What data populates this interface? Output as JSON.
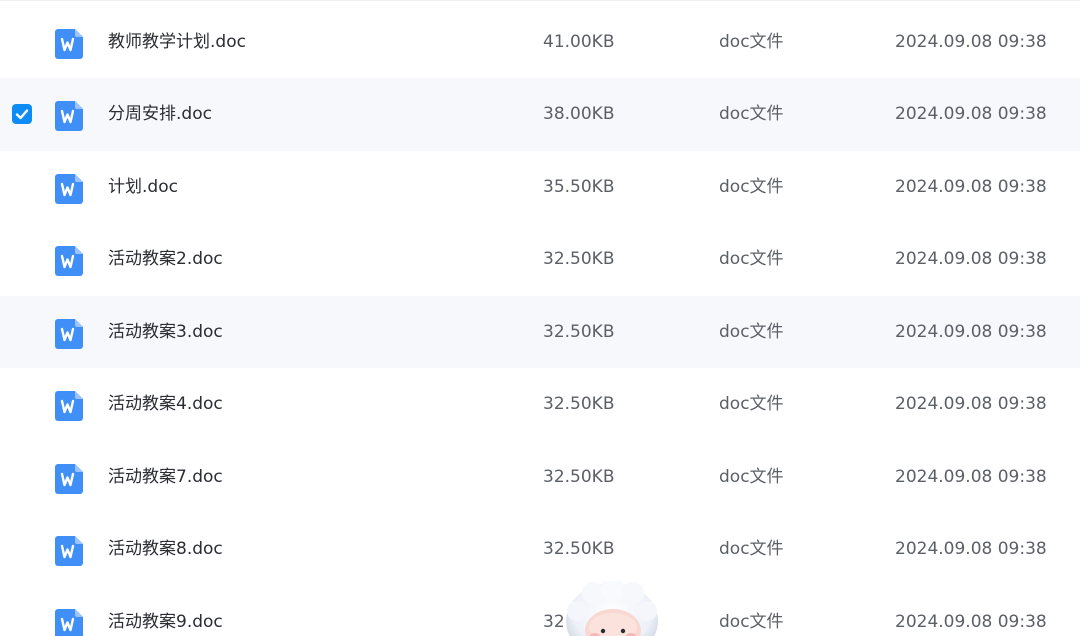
{
  "colors": {
    "accent": "#0d8cf5",
    "doc_icon": "#3f8ff7",
    "row_alt": "#f6f8fc"
  },
  "files": [
    {
      "name": "教师教学计划.doc",
      "size": "41.00KB",
      "type": "doc文件",
      "date": "2024.09.08 09:38",
      "selected": false,
      "icon": "word-doc-icon"
    },
    {
      "name": "分周安排.doc",
      "size": "38.00KB",
      "type": "doc文件",
      "date": "2024.09.08 09:38",
      "selected": true,
      "icon": "word-doc-icon"
    },
    {
      "name": "计划.doc",
      "size": "35.50KB",
      "type": "doc文件",
      "date": "2024.09.08 09:38",
      "selected": false,
      "icon": "word-doc-icon"
    },
    {
      "name": "活动教案2.doc",
      "size": "32.50KB",
      "type": "doc文件",
      "date": "2024.09.08 09:38",
      "selected": false,
      "icon": "word-doc-icon"
    },
    {
      "name": "活动教案3.doc",
      "size": "32.50KB",
      "type": "doc文件",
      "date": "2024.09.08 09:38",
      "selected": false,
      "icon": "word-doc-icon"
    },
    {
      "name": "活动教案4.doc",
      "size": "32.50KB",
      "type": "doc文件",
      "date": "2024.09.08 09:38",
      "selected": false,
      "icon": "word-doc-icon"
    },
    {
      "name": "活动教案7.doc",
      "size": "32.50KB",
      "type": "doc文件",
      "date": "2024.09.08 09:38",
      "selected": false,
      "icon": "word-doc-icon"
    },
    {
      "name": "活动教案8.doc",
      "size": "32.50KB",
      "type": "doc文件",
      "date": "2024.09.08 09:38",
      "selected": false,
      "icon": "word-doc-icon"
    },
    {
      "name": "活动教案9.doc",
      "size": "32",
      "type": "doc文件",
      "date": "2024.09.08 09:38",
      "selected": false,
      "icon": "word-doc-icon"
    }
  ],
  "overlay": {
    "icon": "mascot-sticker-icon"
  }
}
